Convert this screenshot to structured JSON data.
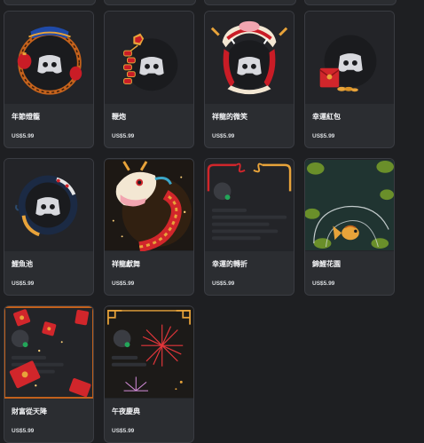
{
  "currency_price": "US$5.99",
  "cards": [
    {
      "name": "年節燈籠",
      "price": "US$5.99",
      "icon": "lantern-ring-frame"
    },
    {
      "name": "鞭炮",
      "price": "US$5.99",
      "icon": "firecracker"
    },
    {
      "name": "祥龍的微笑",
      "price": "US$5.99",
      "icon": "dragon-smile-frame"
    },
    {
      "name": "幸運紅包",
      "price": "US$5.99",
      "icon": "red-envelope"
    },
    {
      "name": "鯉魚池",
      "price": "US$5.99",
      "icon": "koi-pond"
    },
    {
      "name": "祥龍獻舞",
      "price": "US$5.99",
      "icon": "dancing-dragon"
    },
    {
      "name": "幸運的轉折",
      "price": "US$5.99",
      "icon": "lucky-twist-frame"
    },
    {
      "name": "錦鯉花園",
      "price": "US$5.99",
      "icon": "koi-garden"
    },
    {
      "name": "財富從天降",
      "price": "US$5.99",
      "icon": "falling-red-envelopes"
    },
    {
      "name": "午夜慶典",
      "price": "US$5.99",
      "icon": "midnight-fireworks"
    }
  ],
  "colors": {
    "background": "#1e1f22",
    "card": "#2b2d31",
    "avatar": "#1f2023",
    "accent_red": "#d1262b",
    "accent_gold": "#e8a33a"
  }
}
